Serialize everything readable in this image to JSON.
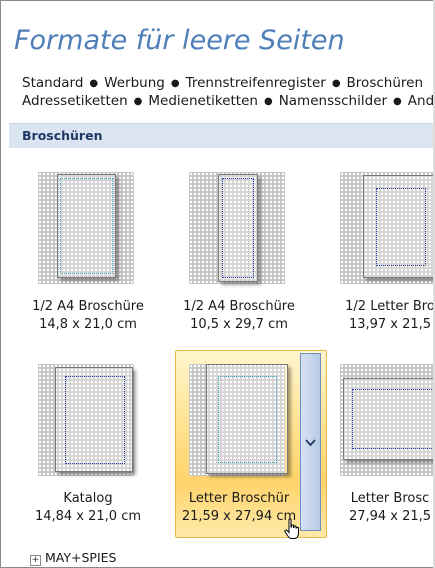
{
  "title": "Formate für leere Seiten",
  "categories_line1": [
    "Standard",
    "Werbung",
    "Trennstreifenregister",
    "Broschüren"
  ],
  "categories_line2": [
    "Adressetiketten",
    "Medienetiketten",
    "Namensschilder",
    "And"
  ],
  "section": {
    "label": "Broschüren"
  },
  "items": [
    {
      "name": "1/2 A4 Broschüre",
      "size": "14,8 x 21,0 cm"
    },
    {
      "name": "1/2 A4 Broschüre",
      "size": "10,5 x 29,7 cm"
    },
    {
      "name": "1/2 Letter Bro",
      "size": "13,97 x 21,5"
    },
    {
      "name": "Katalog",
      "size": "14,84 x 21,0 cm"
    },
    {
      "name": "Letter Broschür",
      "size": "21,59 x 27,94 cm"
    },
    {
      "name": "Letter Brosc",
      "size": "27,94 x 21,5"
    }
  ],
  "tree": {
    "expander": "+",
    "label": "MAY+SPIES"
  },
  "icons": {
    "dropdown": "chevron-down-icon",
    "cursor": "hand-cursor-icon",
    "separator": "bullet"
  },
  "colors": {
    "title": "#4f7fb8",
    "section_bg": "#dbe5f1",
    "hover": "#ffd36a"
  }
}
